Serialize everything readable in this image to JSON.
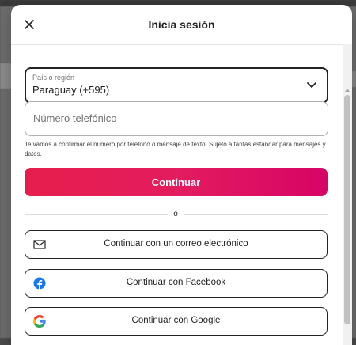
{
  "modal": {
    "title": "Inicia sesión",
    "close_icon": "close-icon"
  },
  "country": {
    "label": "País o región",
    "value": "Paraguay (+595)",
    "icon": "chevron-down-icon"
  },
  "phone": {
    "placeholder": "Número telefónico",
    "value": ""
  },
  "disclaimer": "Te vamos a confirmar el número por teléfono o mensaje de texto. Sujeto a tarifas estándar para mensajes y datos.",
  "continue_label": "Continuar",
  "divider_text": "o",
  "social": {
    "email": {
      "label": "Continuar con un correo electrónico",
      "icon": "envelope-icon"
    },
    "facebook": {
      "label": "Continuar con Facebook",
      "icon": "facebook-icon"
    },
    "google": {
      "label": "Continuar con Google",
      "icon": "google-icon"
    }
  },
  "colors": {
    "accent": "#e31c5f",
    "facebook": "#1877f2"
  }
}
